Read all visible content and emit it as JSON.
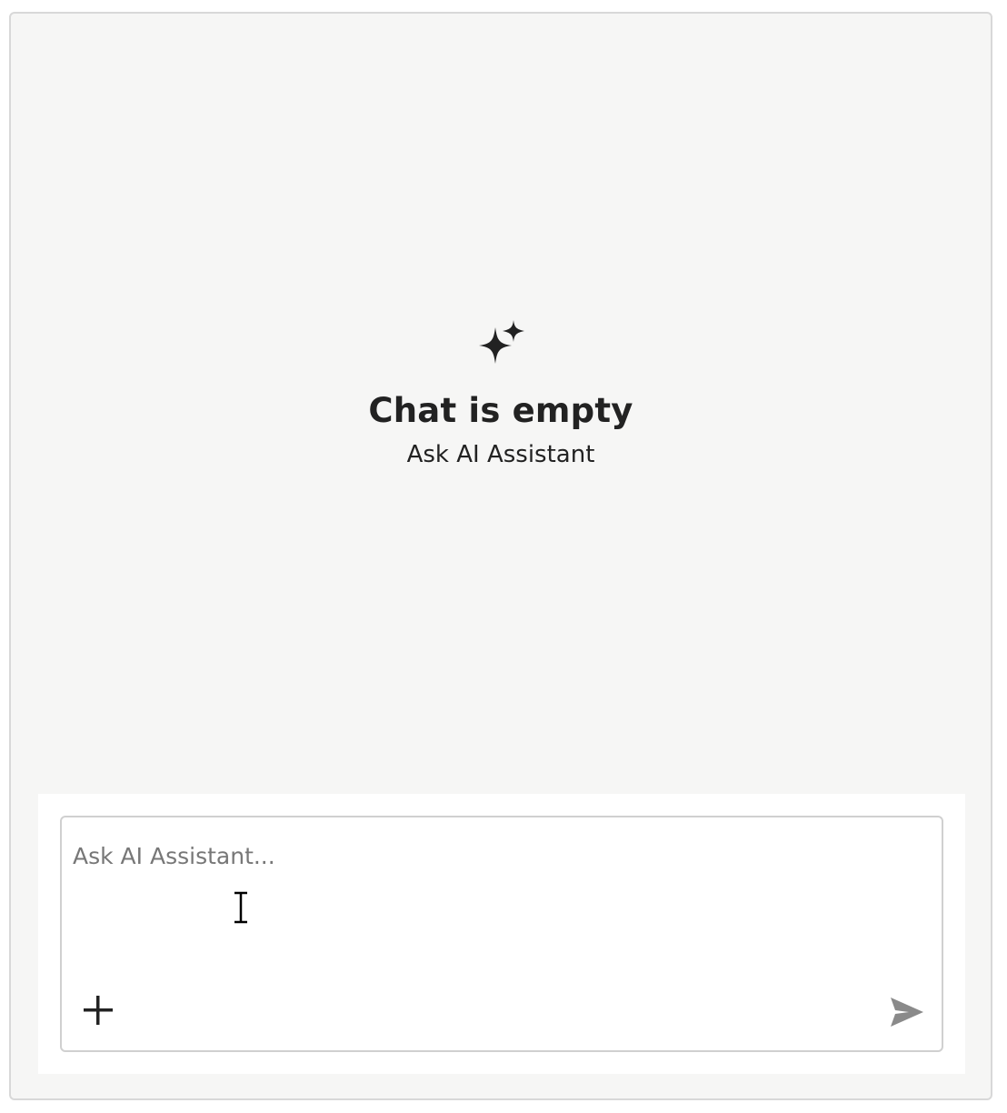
{
  "empty_state": {
    "icon": "sparkle-icon",
    "title": "Chat is empty",
    "subtitle": "Ask AI Assistant"
  },
  "composer": {
    "input": {
      "value": "",
      "placeholder": "Ask AI Assistant..."
    },
    "add_icon": "plus-icon",
    "send_icon": "send-icon"
  },
  "colors": {
    "panel_background": "#f6f6f5",
    "composer_background": "#ffffff",
    "text_primary": "#222222",
    "placeholder": "#777777",
    "send_disabled": "#8a8a8a",
    "border": "#d0d0d0"
  }
}
